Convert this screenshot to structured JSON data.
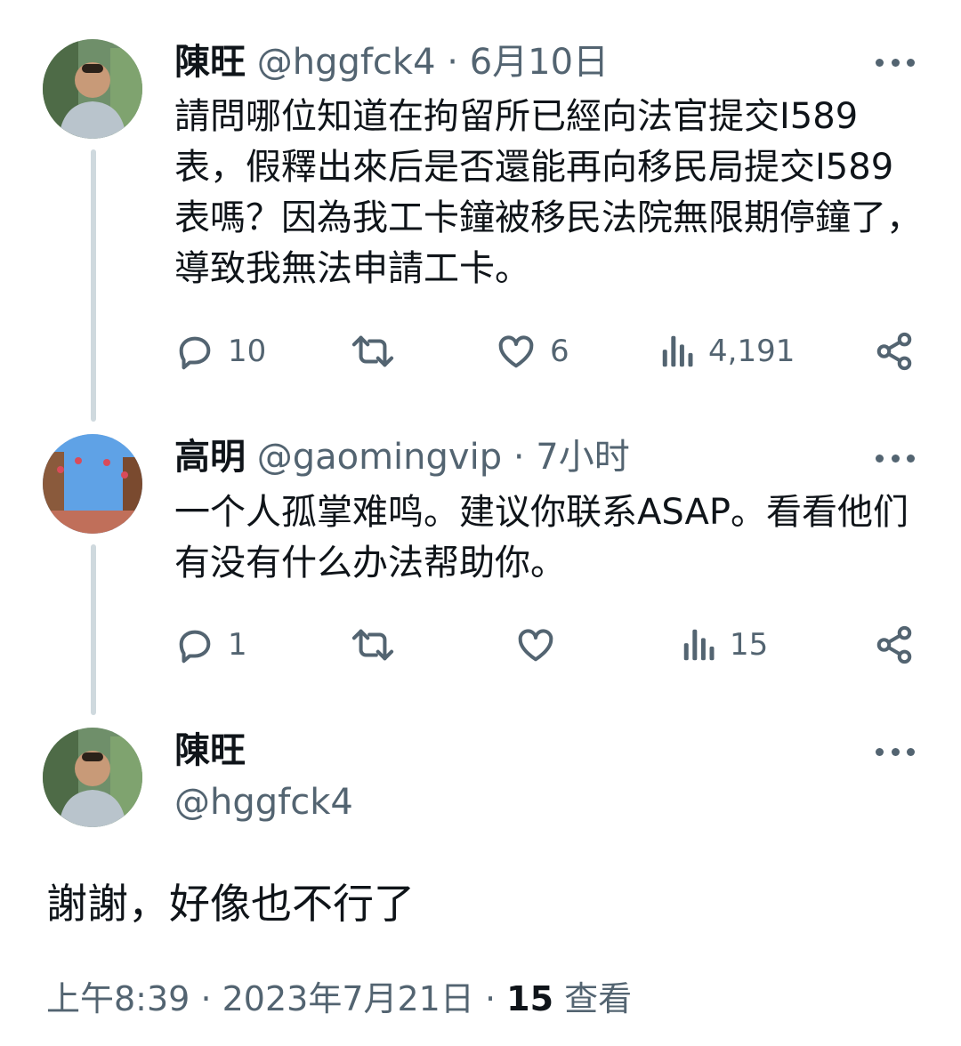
{
  "tweets": [
    {
      "name": "陳旺",
      "handle": "@hggfck4",
      "separator": "·",
      "date": "6月10日",
      "text": "請問哪位知道在拘留所已經向法官提交I589表，假釋出來后是否還能再向移民局提交I589表嗎？因為我工卡鐘被移民法院無限期停鐘了，導致我無法申請工卡。",
      "replies": "10",
      "likes": "6",
      "views": "4,191"
    },
    {
      "name": "高明",
      "handle": "@gaomingvip",
      "separator": "·",
      "date": "7小时",
      "text": "一个人孤掌难鸣。建议你联系ASAP。看看他们有没有什么办法帮助你。",
      "replies": "1",
      "likes": "",
      "views": "15"
    }
  ],
  "focused": {
    "name": "陳旺",
    "handle": "@hggfck4",
    "text": "謝謝，好像也不行了",
    "time": "上午8:39",
    "separator": "·",
    "date": "2023年7月21日",
    "views_count": "15",
    "views_label": "查看"
  },
  "icons": [
    "reply-icon",
    "retweet-icon",
    "like-icon",
    "views-icon",
    "share-icon",
    "more-icon"
  ],
  "colors": {
    "text": "#0f1419",
    "secondary": "#536471",
    "thread_line": "#cfd9de"
  }
}
